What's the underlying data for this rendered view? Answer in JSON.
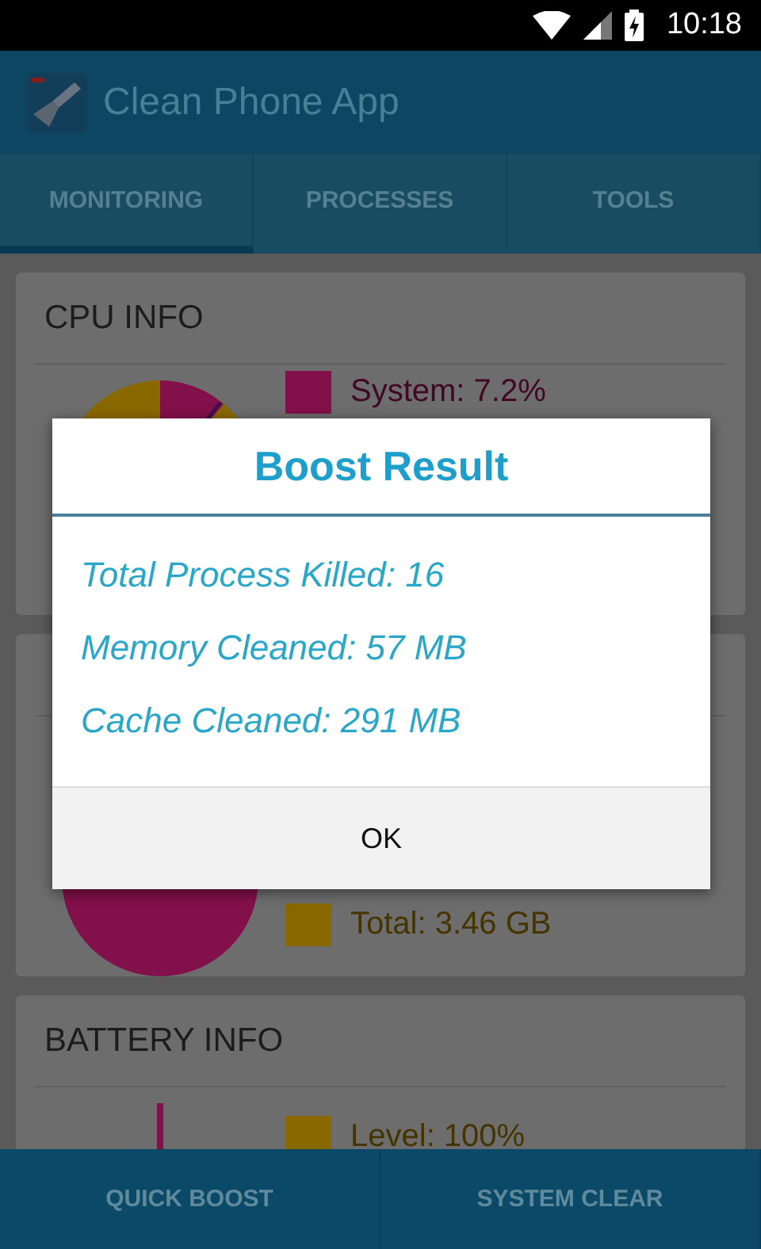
{
  "status_bar": {
    "time": "10:18"
  },
  "app_bar": {
    "title": "Clean Phone App"
  },
  "tabs": [
    {
      "label": "MONITORING",
      "selected": true
    },
    {
      "label": "PROCESSES",
      "selected": false
    },
    {
      "label": "TOOLS",
      "selected": false
    }
  ],
  "cards": [
    {
      "title": "CPU INFO",
      "legend": [
        {
          "label": "System: 7.2%",
          "color": "#82104a"
        }
      ]
    },
    {
      "legend": [
        {
          "label": "Total: 3.46 GB",
          "color": "#8a6800"
        }
      ]
    },
    {
      "title": "BATTERY INFO",
      "legend": [
        {
          "label": "Level: 100%",
          "color": "#8a6800"
        }
      ]
    }
  ],
  "bottom_bar": {
    "buttons": [
      "QUICK BOOST",
      "SYSTEM CLEAR"
    ]
  },
  "dialog": {
    "title": "Boost Result",
    "lines": [
      "Total Process Killed: 16",
      "Memory Cleaned: 57 MB",
      "Cache Cleaned: 291 MB"
    ],
    "button": "OK"
  }
}
